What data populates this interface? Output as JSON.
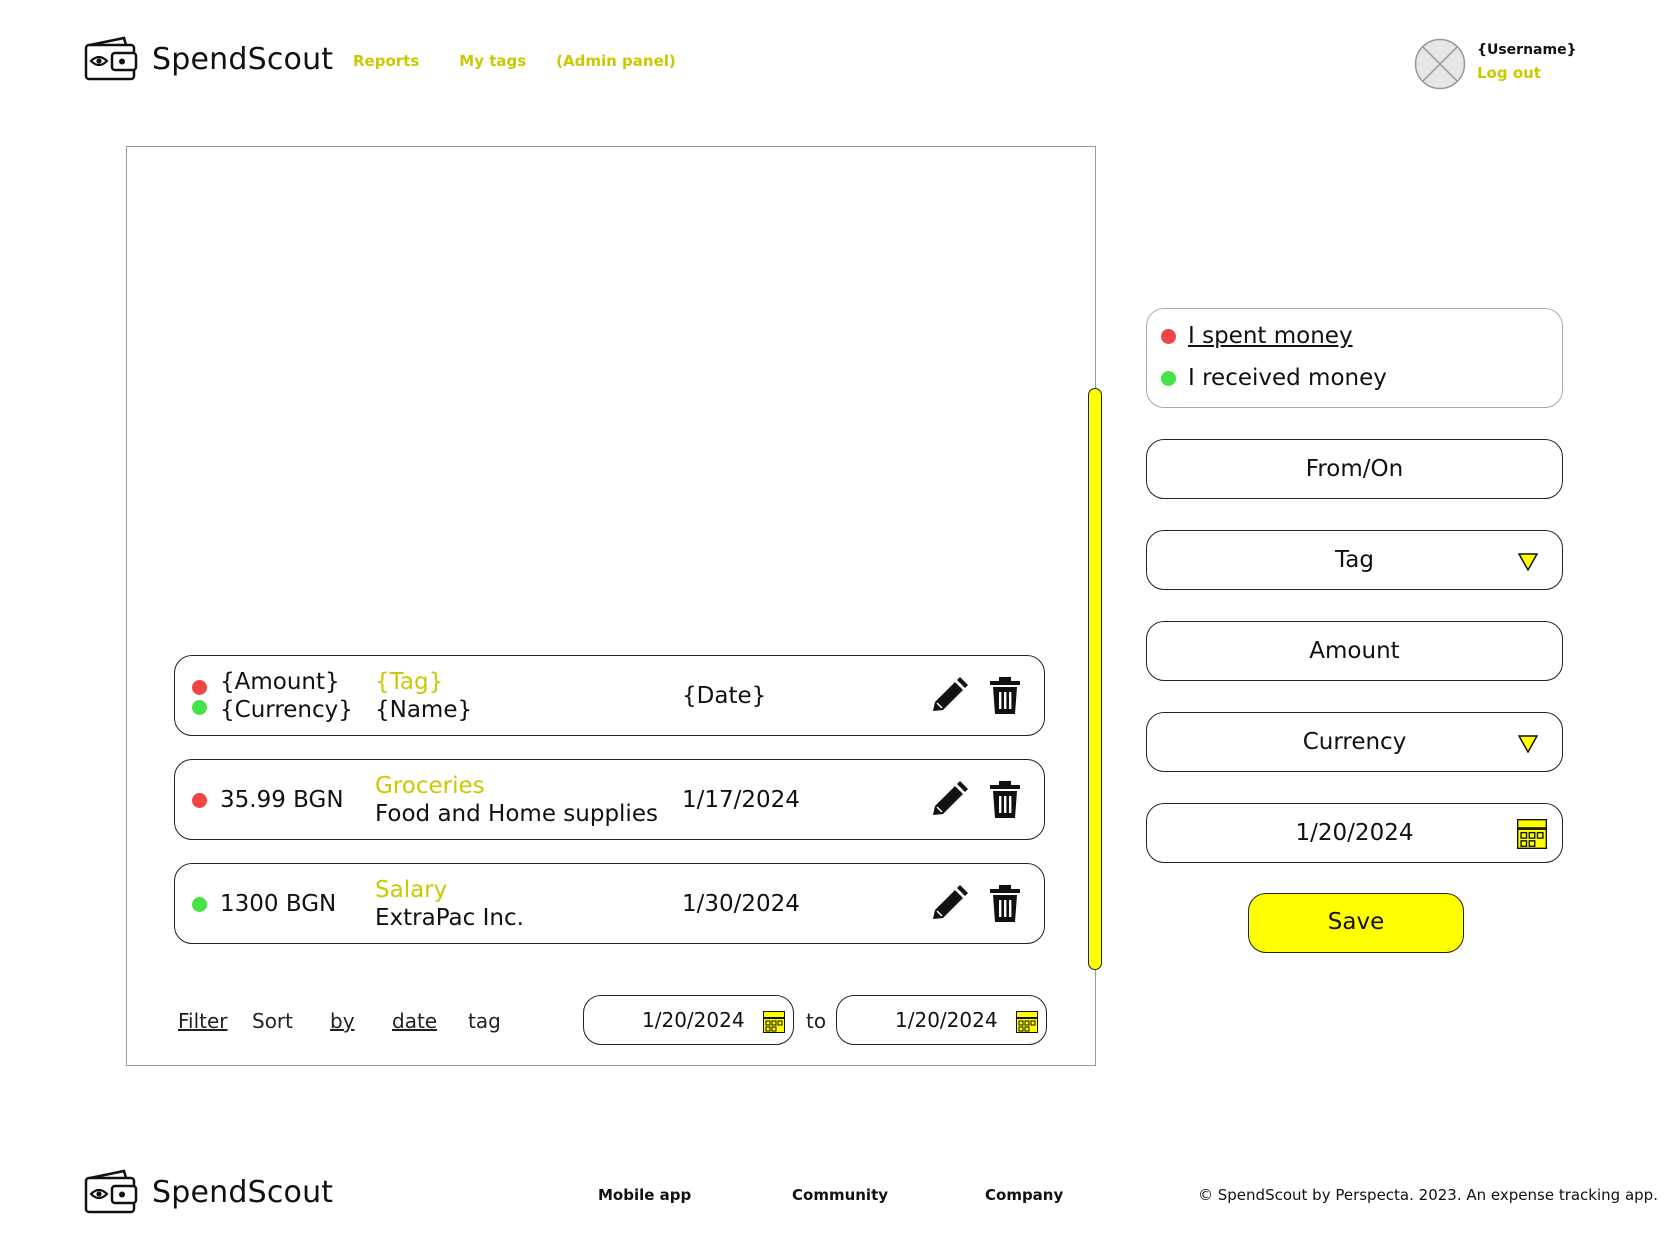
{
  "brand": {
    "name": "SpendScout",
    "icon": "wallet-eye-icon"
  },
  "nav": {
    "reports": "Reports",
    "my_tags": "My tags",
    "admin_panel": "(Admin panel)"
  },
  "user": {
    "name": "{Username}",
    "logout": "Log out",
    "avatar_icon": "avatar-placeholder-icon"
  },
  "transactions": [
    {
      "indicators": [
        "spent",
        "received"
      ],
      "amount": "{Amount}",
      "currency": "{Currency}",
      "tag": "{Tag}",
      "name": "{Name}",
      "date": "{Date}"
    },
    {
      "type": "spent",
      "amount_text": "35.99 BGN",
      "tag": "Groceries",
      "name": "Food and Home supplies",
      "date": "1/17/2024"
    },
    {
      "type": "received",
      "amount_text": "1300 BGN",
      "tag": "Salary",
      "name": "ExtraPac Inc.",
      "date": "1/30/2024"
    }
  ],
  "filter_bar": {
    "filter": "Filter",
    "sort": "Sort",
    "by": "by",
    "date": "date",
    "tag": "tag",
    "from_date": "1/20/2024",
    "to": "to",
    "to_date": "1/20/2024"
  },
  "form": {
    "spent_label": "I spent money",
    "received_label": "I received money",
    "from_on": "From/On",
    "tag": "Tag",
    "amount": "Amount",
    "currency": "Currency",
    "date": "1/20/2024",
    "save": "Save"
  },
  "footer": {
    "mobile_app": "Mobile app",
    "community": "Community",
    "company": "Company",
    "copyright": "© SpendScout by Perspecta. 2023. An expense tracking app."
  },
  "colors": {
    "accent_yellow": "#ffff00",
    "link_yellow": "#c9c900",
    "spent_red": "#f04545",
    "received_green": "#45e345"
  }
}
